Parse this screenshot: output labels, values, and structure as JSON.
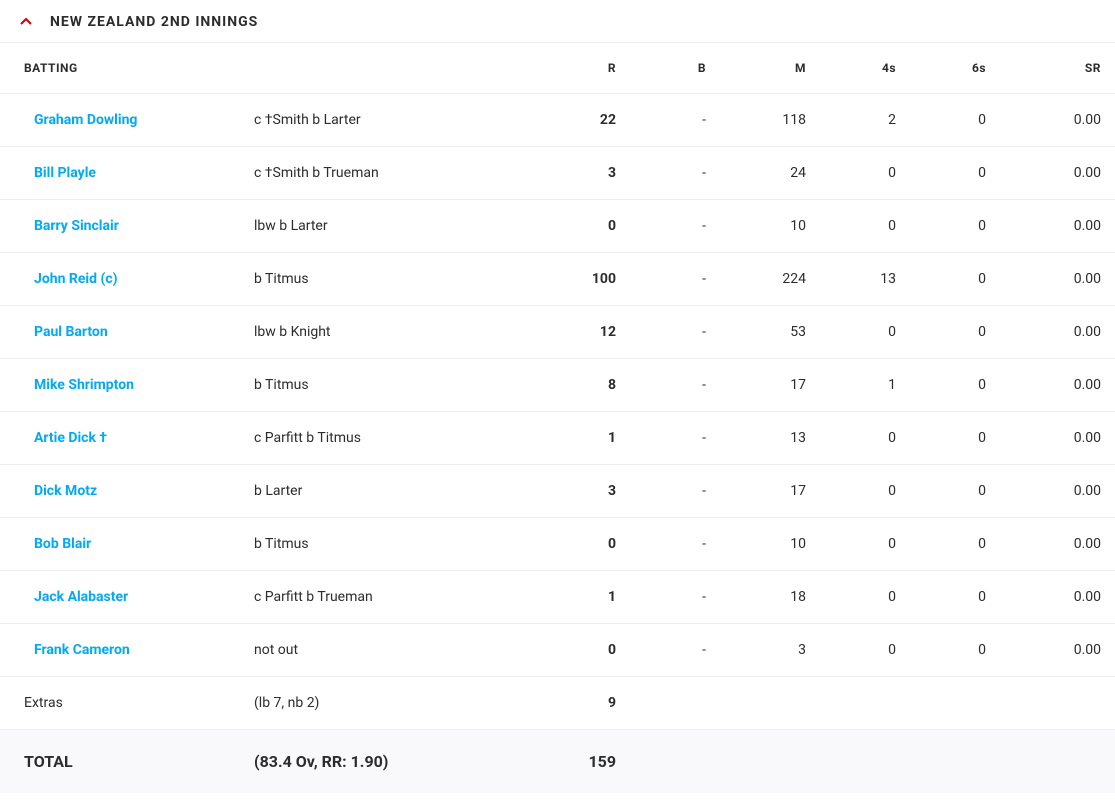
{
  "header": {
    "title": "NEW ZEALAND 2ND INNINGS"
  },
  "columns": {
    "batting": "BATTING",
    "r": "R",
    "b": "B",
    "m": "M",
    "fours": "4s",
    "sixes": "6s",
    "sr": "SR"
  },
  "rows": [
    {
      "name": "Graham Dowling",
      "dismissal": "c †Smith b Larter",
      "r": "22",
      "b": "-",
      "m": "118",
      "fours": "2",
      "sixes": "0",
      "sr": "0.00"
    },
    {
      "name": "Bill Playle",
      "dismissal": "c †Smith b Trueman",
      "r": "3",
      "b": "-",
      "m": "24",
      "fours": "0",
      "sixes": "0",
      "sr": "0.00"
    },
    {
      "name": "Barry Sinclair",
      "dismissal": "lbw b Larter",
      "r": "0",
      "b": "-",
      "m": "10",
      "fours": "0",
      "sixes": "0",
      "sr": "0.00"
    },
    {
      "name": "John Reid (c)",
      "dismissal": "b Titmus",
      "r": "100",
      "b": "-",
      "m": "224",
      "fours": "13",
      "sixes": "0",
      "sr": "0.00"
    },
    {
      "name": "Paul Barton",
      "dismissal": "lbw b Knight",
      "r": "12",
      "b": "-",
      "m": "53",
      "fours": "0",
      "sixes": "0",
      "sr": "0.00"
    },
    {
      "name": "Mike Shrimpton",
      "dismissal": "b Titmus",
      "r": "8",
      "b": "-",
      "m": "17",
      "fours": "1",
      "sixes": "0",
      "sr": "0.00"
    },
    {
      "name": "Artie Dick †",
      "dismissal": "c Parfitt b Titmus",
      "r": "1",
      "b": "-",
      "m": "13",
      "fours": "0",
      "sixes": "0",
      "sr": "0.00"
    },
    {
      "name": "Dick Motz",
      "dismissal": "b Larter",
      "r": "3",
      "b": "-",
      "m": "17",
      "fours": "0",
      "sixes": "0",
      "sr": "0.00"
    },
    {
      "name": "Bob Blair",
      "dismissal": "b Titmus",
      "r": "0",
      "b": "-",
      "m": "10",
      "fours": "0",
      "sixes": "0",
      "sr": "0.00"
    },
    {
      "name": "Jack Alabaster",
      "dismissal": "c Parfitt b Trueman",
      "r": "1",
      "b": "-",
      "m": "18",
      "fours": "0",
      "sixes": "0",
      "sr": "0.00"
    },
    {
      "name": "Frank Cameron",
      "dismissal": "not out",
      "r": "0",
      "b": "-",
      "m": "3",
      "fours": "0",
      "sixes": "0",
      "sr": "0.00"
    }
  ],
  "extras": {
    "label": "Extras",
    "detail": "(lb 7, nb 2)",
    "r": "9"
  },
  "total": {
    "label": "TOTAL",
    "detail": "(83.4 Ov, RR: 1.90)",
    "r": "159"
  }
}
